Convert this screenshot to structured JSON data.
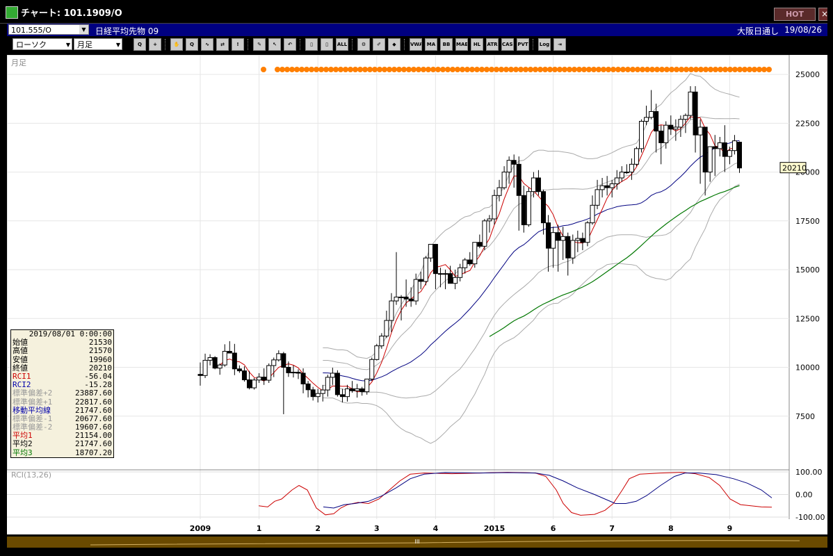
{
  "window": {
    "title": "チャート: 101.1909/O",
    "hot_label": "HOT",
    "close_label": "×"
  },
  "infobar": {
    "symbol": "101.555/O",
    "instrument": "日経平均先物 09",
    "exchange": "大阪日通し",
    "date": "19/08/26"
  },
  "toolbar": {
    "chart_type": "ローソク",
    "period": "月足",
    "buttons": [
      {
        "name": "zoom-icon",
        "text": "Q"
      },
      {
        "name": "crosshair-icon",
        "text": "+"
      },
      {
        "name": "hand-icon",
        "text": "✋"
      },
      {
        "name": "zoom-reset-icon",
        "text": "Q"
      },
      {
        "name": "trend-icon",
        "text": "∿"
      },
      {
        "name": "compare-icon",
        "text": "⇄"
      },
      {
        "name": "alert-icon",
        "text": "!"
      },
      {
        "name": "pen-icon",
        "text": "✎"
      },
      {
        "name": "cursor-icon",
        "text": "↖"
      },
      {
        "name": "undo-icon",
        "text": "↶"
      },
      {
        "name": "candle-icon",
        "text": "▯"
      },
      {
        "name": "candle2-icon",
        "text": "▯"
      },
      {
        "name": "all-icon",
        "text": "ALL"
      },
      {
        "name": "settings-icon",
        "text": "⚙"
      },
      {
        "name": "brush-icon",
        "text": "✐"
      },
      {
        "name": "color-icon",
        "text": "◆"
      },
      {
        "name": "vwap-icon",
        "text": "VWAP"
      },
      {
        "name": "ma-icon",
        "text": "MA"
      },
      {
        "name": "bb-icon",
        "text": "BB"
      },
      {
        "name": "mae-icon",
        "text": "MAE"
      },
      {
        "name": "hl-icon",
        "text": "HL"
      },
      {
        "name": "atr-icon",
        "text": "ATR"
      },
      {
        "name": "cash-icon",
        "text": "CASH"
      },
      {
        "name": "pvt-icon",
        "text": "PVT"
      },
      {
        "name": "log-icon",
        "text": "Log"
      },
      {
        "name": "export-icon",
        "text": "⇥"
      }
    ]
  },
  "chart_data": {
    "type": "candlestick",
    "period_label": "月足",
    "indicator_label": "RCI(13,26)",
    "y_ticks": [
      25000,
      22500,
      20000,
      17500,
      15000,
      12500,
      10000,
      7500
    ],
    "y_tick_labels": [
      "25000",
      "22500",
      "20000",
      "17500",
      "15000",
      "12500",
      "10000",
      "7500"
    ],
    "ylim": [
      5000,
      26000
    ],
    "rci_ticks": [
      "100.00",
      "0.00",
      "-100.00"
    ],
    "x_labels": [
      {
        "i": 0,
        "label": "2009"
      },
      {
        "i": 12,
        "label": "1"
      },
      {
        "i": 24,
        "label": "2"
      },
      {
        "i": 36,
        "label": "3"
      },
      {
        "i": 48,
        "label": "4"
      },
      {
        "i": 60,
        "label": "2015"
      },
      {
        "i": 72,
        "label": "6"
      },
      {
        "i": 84,
        "label": "7"
      },
      {
        "i": 96,
        "label": "8"
      },
      {
        "i": 108,
        "label": "9"
      }
    ],
    "last_price": "20210",
    "candles": [
      {
        "o": 9640,
        "h": 10250,
        "l": 9060,
        "c": 9580
      },
      {
        "o": 9580,
        "h": 10700,
        "l": 9450,
        "c": 10360
      },
      {
        "o": 10360,
        "h": 10670,
        "l": 10100,
        "c": 10500
      },
      {
        "o": 10500,
        "h": 10570,
        "l": 9900,
        "c": 9960
      },
      {
        "o": 9960,
        "h": 10200,
        "l": 9620,
        "c": 10120
      },
      {
        "o": 10120,
        "h": 11180,
        "l": 10030,
        "c": 10820
      },
      {
        "o": 10820,
        "h": 11340,
        "l": 10800,
        "c": 10730
      },
      {
        "o": 10730,
        "h": 11200,
        "l": 9600,
        "c": 9920
      },
      {
        "o": 9920,
        "h": 10100,
        "l": 9720,
        "c": 9820
      },
      {
        "o": 9820,
        "h": 10050,
        "l": 9270,
        "c": 9360
      },
      {
        "o": 9360,
        "h": 9820,
        "l": 8870,
        "c": 8950
      },
      {
        "o": 8950,
        "h": 9450,
        "l": 8860,
        "c": 9350
      },
      {
        "o": 9350,
        "h": 9700,
        "l": 9200,
        "c": 9500
      },
      {
        "o": 9500,
        "h": 9950,
        "l": 9100,
        "c": 9340
      },
      {
        "o": 9340,
        "h": 10200,
        "l": 9200,
        "c": 10090
      },
      {
        "o": 10090,
        "h": 10500,
        "l": 9500,
        "c": 10380
      },
      {
        "o": 10380,
        "h": 10870,
        "l": 10300,
        "c": 10700
      },
      {
        "o": 10700,
        "h": 10790,
        "l": 7600,
        "c": 10000
      },
      {
        "o": 10000,
        "h": 10300,
        "l": 9510,
        "c": 9720
      },
      {
        "o": 9720,
        "h": 10100,
        "l": 9480,
        "c": 9750
      },
      {
        "o": 9750,
        "h": 9900,
        "l": 9400,
        "c": 9700
      },
      {
        "o": 9700,
        "h": 9950,
        "l": 8670,
        "c": 9150
      },
      {
        "o": 9150,
        "h": 9300,
        "l": 8460,
        "c": 8850
      },
      {
        "o": 8850,
        "h": 9000,
        "l": 8300,
        "c": 8500
      },
      {
        "o": 8500,
        "h": 8900,
        "l": 8200,
        "c": 8660
      },
      {
        "o": 8660,
        "h": 9100,
        "l": 8250,
        "c": 8840
      },
      {
        "o": 8840,
        "h": 9620,
        "l": 8500,
        "c": 9490
      },
      {
        "o": 9490,
        "h": 9980,
        "l": 9100,
        "c": 9700
      },
      {
        "o": 9700,
        "h": 9850,
        "l": 8500,
        "c": 8600
      },
      {
        "o": 8600,
        "h": 8900,
        "l": 8200,
        "c": 8500
      },
      {
        "o": 8500,
        "h": 9100,
        "l": 8250,
        "c": 8900
      },
      {
        "o": 8900,
        "h": 9300,
        "l": 8700,
        "c": 8800
      },
      {
        "o": 8800,
        "h": 9150,
        "l": 8450,
        "c": 8900
      },
      {
        "o": 8900,
        "h": 9000,
        "l": 8550,
        "c": 8750
      },
      {
        "o": 8750,
        "h": 9400,
        "l": 8600,
        "c": 9400
      },
      {
        "o": 9400,
        "h": 10500,
        "l": 9300,
        "c": 10400
      },
      {
        "o": 10400,
        "h": 11200,
        "l": 10350,
        "c": 11100
      },
      {
        "o": 11100,
        "h": 11750,
        "l": 10950,
        "c": 11600
      },
      {
        "o": 11600,
        "h": 12900,
        "l": 11500,
        "c": 12400
      },
      {
        "o": 12400,
        "h": 13800,
        "l": 11800,
        "c": 13400
      },
      {
        "o": 13400,
        "h": 15900,
        "l": 13200,
        "c": 13600
      },
      {
        "o": 13600,
        "h": 13700,
        "l": 12400,
        "c": 13600
      },
      {
        "o": 13600,
        "h": 14500,
        "l": 13100,
        "c": 13500
      },
      {
        "o": 13500,
        "h": 14100,
        "l": 13100,
        "c": 13400
      },
      {
        "o": 13400,
        "h": 14800,
        "l": 13200,
        "c": 14500
      },
      {
        "o": 14500,
        "h": 14900,
        "l": 14000,
        "c": 14400
      },
      {
        "o": 14400,
        "h": 15700,
        "l": 14200,
        "c": 15600
      },
      {
        "o": 15600,
        "h": 16300,
        "l": 15400,
        "c": 16300
      },
      {
        "o": 16300,
        "h": 16300,
        "l": 14000,
        "c": 14800
      },
      {
        "o": 14800,
        "h": 15100,
        "l": 14100,
        "c": 14800
      },
      {
        "o": 14800,
        "h": 15000,
        "l": 14000,
        "c": 14800
      },
      {
        "o": 14800,
        "h": 15200,
        "l": 14300,
        "c": 14300
      },
      {
        "o": 14300,
        "h": 15000,
        "l": 14000,
        "c": 14600
      },
      {
        "o": 14600,
        "h": 15300,
        "l": 14400,
        "c": 15100
      },
      {
        "o": 15100,
        "h": 15600,
        "l": 14800,
        "c": 15500
      },
      {
        "o": 15500,
        "h": 15900,
        "l": 15200,
        "c": 15300
      },
      {
        "o": 15300,
        "h": 16400,
        "l": 15100,
        "c": 16400
      },
      {
        "o": 16400,
        "h": 16800,
        "l": 16100,
        "c": 16200
      },
      {
        "o": 16200,
        "h": 17600,
        "l": 16000,
        "c": 17500
      },
      {
        "o": 17500,
        "h": 17800,
        "l": 16900,
        "c": 17600
      },
      {
        "o": 17600,
        "h": 19100,
        "l": 17300,
        "c": 18800
      },
      {
        "o": 18800,
        "h": 19600,
        "l": 18500,
        "c": 19200
      },
      {
        "o": 19200,
        "h": 20300,
        "l": 19100,
        "c": 20000
      },
      {
        "o": 20000,
        "h": 20800,
        "l": 19400,
        "c": 20600
      },
      {
        "o": 20600,
        "h": 20900,
        "l": 19200,
        "c": 20400
      },
      {
        "o": 20400,
        "h": 20800,
        "l": 17000,
        "c": 18800
      },
      {
        "o": 18800,
        "h": 19300,
        "l": 16900,
        "c": 17300
      },
      {
        "o": 17300,
        "h": 19200,
        "l": 17200,
        "c": 19000
      },
      {
        "o": 19000,
        "h": 20000,
        "l": 18700,
        "c": 19700
      },
      {
        "o": 19700,
        "h": 20100,
        "l": 18800,
        "c": 19000
      },
      {
        "o": 19000,
        "h": 19100,
        "l": 16800,
        "c": 17400
      },
      {
        "o": 17400,
        "h": 17800,
        "l": 14900,
        "c": 16100
      },
      {
        "o": 16100,
        "h": 17200,
        "l": 15100,
        "c": 16900
      },
      {
        "o": 16900,
        "h": 17300,
        "l": 14900,
        "c": 16500
      },
      {
        "o": 16500,
        "h": 17200,
        "l": 15500,
        "c": 16700
      },
      {
        "o": 16700,
        "h": 16900,
        "l": 14700,
        "c": 15600
      },
      {
        "o": 15600,
        "h": 16800,
        "l": 15300,
        "c": 16500
      },
      {
        "o": 16500,
        "h": 17000,
        "l": 15900,
        "c": 16600
      },
      {
        "o": 16600,
        "h": 16900,
        "l": 16000,
        "c": 16400
      },
      {
        "o": 16400,
        "h": 17500,
        "l": 16200,
        "c": 17400
      },
      {
        "o": 17400,
        "h": 18800,
        "l": 17300,
        "c": 18300
      },
      {
        "o": 18300,
        "h": 19600,
        "l": 18100,
        "c": 19100
      },
      {
        "o": 19100,
        "h": 19700,
        "l": 18700,
        "c": 19300
      },
      {
        "o": 19300,
        "h": 19800,
        "l": 18800,
        "c": 19200
      },
      {
        "o": 19200,
        "h": 19600,
        "l": 18700,
        "c": 19400
      },
      {
        "o": 19400,
        "h": 20100,
        "l": 19100,
        "c": 19700
      },
      {
        "o": 19700,
        "h": 20300,
        "l": 19500,
        "c": 20000
      },
      {
        "o": 20000,
        "h": 20400,
        "l": 19900,
        "c": 20000
      },
      {
        "o": 20000,
        "h": 20700,
        "l": 19600,
        "c": 20400
      },
      {
        "o": 20400,
        "h": 21300,
        "l": 20300,
        "c": 21200
      },
      {
        "o": 21200,
        "h": 22700,
        "l": 21000,
        "c": 22600
      },
      {
        "o": 22600,
        "h": 23400,
        "l": 22400,
        "c": 22800
      },
      {
        "o": 22800,
        "h": 24200,
        "l": 22700,
        "c": 23100
      },
      {
        "o": 23100,
        "h": 23500,
        "l": 21000,
        "c": 22100
      },
      {
        "o": 22100,
        "h": 22400,
        "l": 20400,
        "c": 21500
      },
      {
        "o": 21500,
        "h": 22600,
        "l": 21200,
        "c": 22400
      },
      {
        "o": 22400,
        "h": 22900,
        "l": 21900,
        "c": 22200
      },
      {
        "o": 22200,
        "h": 22700,
        "l": 21600,
        "c": 22300
      },
      {
        "o": 22300,
        "h": 22900,
        "l": 21800,
        "c": 22700
      },
      {
        "o": 22700,
        "h": 23000,
        "l": 22000,
        "c": 22900
      },
      {
        "o": 22900,
        "h": 24400,
        "l": 22700,
        "c": 24100
      },
      {
        "o": 24100,
        "h": 24400,
        "l": 21000,
        "c": 21900
      },
      {
        "o": 21900,
        "h": 22700,
        "l": 19400,
        "c": 22300
      },
      {
        "o": 22300,
        "h": 22300,
        "l": 18800,
        "c": 20000
      },
      {
        "o": 20000,
        "h": 21100,
        "l": 19500,
        "c": 21300
      },
      {
        "o": 21300,
        "h": 21900,
        "l": 19800,
        "c": 21200
      },
      {
        "o": 21200,
        "h": 21800,
        "l": 20800,
        "c": 21500
      },
      {
        "o": 21500,
        "h": 22400,
        "l": 20000,
        "c": 20800
      },
      {
        "o": 20800,
        "h": 21300,
        "l": 20400,
        "c": 21100
      },
      {
        "o": 21100,
        "h": 21900,
        "l": 20900,
        "c": 21600
      },
      {
        "o": 21530,
        "h": 21570,
        "l": 19960,
        "c": 20210
      }
    ]
  },
  "info_panel": {
    "datetime": "2019/08/01 0:00:00",
    "rows": [
      {
        "label": "始値",
        "value": "21530",
        "color": "#000000"
      },
      {
        "label": "高値",
        "value": "21570",
        "color": "#000000"
      },
      {
        "label": "安値",
        "value": "19960",
        "color": "#000000"
      },
      {
        "label": "終値",
        "value": "20210",
        "color": "#000000"
      },
      {
        "label": "RCI1",
        "value": "-56.04",
        "color": "#cc0000"
      },
      {
        "label": "RCI2",
        "value": "-15.28",
        "color": "#0000aa"
      },
      {
        "label": "標準偏差+2",
        "value": "23887.60",
        "color": "#999999"
      },
      {
        "label": "標準偏差+1",
        "value": "22817.60",
        "color": "#999999"
      },
      {
        "label": "移動平均線",
        "value": "21747.60",
        "color": "#0000aa"
      },
      {
        "label": "標準偏差-1",
        "value": "20677.60",
        "color": "#999999"
      },
      {
        "label": "標準偏差-2",
        "value": "19607.60",
        "color": "#999999"
      },
      {
        "label": "平均1",
        "value": "21154.00",
        "color": "#cc0000"
      },
      {
        "label": "平均2",
        "value": "21747.60",
        "color": "#000000"
      },
      {
        "label": "平均3",
        "value": "18707.20",
        "color": "#007700"
      }
    ]
  }
}
